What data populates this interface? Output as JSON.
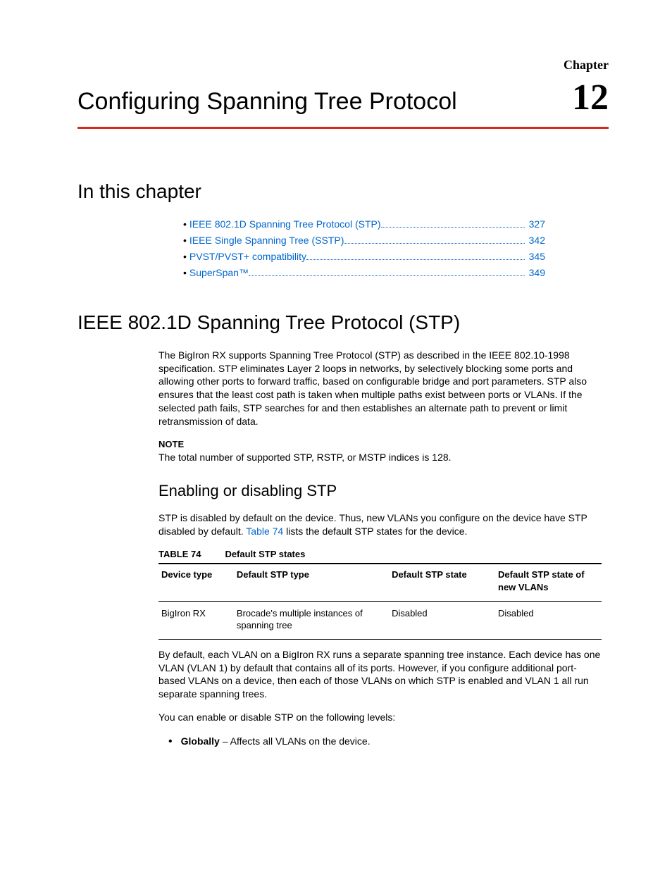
{
  "header": {
    "chapter_label": "Chapter",
    "title": "Configuring Spanning Tree Protocol",
    "number": "12"
  },
  "sections": {
    "in_this_chapter": "In this chapter",
    "ieee_stp": "IEEE  802.1D Spanning Tree Protocol (STP)"
  },
  "toc": [
    {
      "label": "IEEE 802.1D Spanning Tree Protocol (STP)",
      "page": "327"
    },
    {
      "label": "IEEE Single Spanning Tree (SSTP)",
      "page": "342"
    },
    {
      "label": "PVST/PVST+ compatibility",
      "page": "345"
    },
    {
      "label": "SuperSpan™",
      "page": "349"
    }
  ],
  "stp": {
    "intro": "The BigIron RX supports Spanning Tree Protocol (STP) as described in the IEEE 802.10-1998 specification. STP eliminates Layer 2 loops in networks, by selectively blocking some ports and allowing other ports to forward traffic, based on configurable bridge and port parameters.   STP also ensures that the least cost path is taken when multiple paths exist between ports or VLANs. If the selected path fails, STP searches for and then establishes an alternate path to prevent or limit retransmission of data.",
    "note_title": "NOTE",
    "note_text": "The  total number of supported  STP,  RSTP, or MSTP  indices is 128.",
    "enable_heading": "Enabling or disabling STP",
    "enable_para_pre": "STP is disabled by default on the device. Thus, new VLANs you configure on the device have STP disabled by default. ",
    "enable_link": "Table 74",
    "enable_para_post": " lists the default STP states for the device.",
    "table_label": "TABLE 74",
    "table_name": "Default STP states",
    "table_headers": [
      "Device type",
      "Default STP type",
      "Default STP state",
      "Default STP state of new VLANs"
    ],
    "table_row": [
      "BigIron RX",
      "Brocade's multiple instances of spanning tree",
      "Disabled",
      "Disabled"
    ],
    "after_table": "By default, each VLAN on a BigIron RX runs a separate spanning tree instance. Each device has one VLAN (VLAN 1) by default that contains all of its ports. However, if you configure additional port-based VLANs on a device, then each of those VLANs on which STP is enabled and VLAN 1 all run separate spanning trees.",
    "levels_intro": "You can enable or disable STP on the following levels:",
    "bullet_bold": "Globally",
    "bullet_rest": " – Affects all VLANs on the device."
  }
}
